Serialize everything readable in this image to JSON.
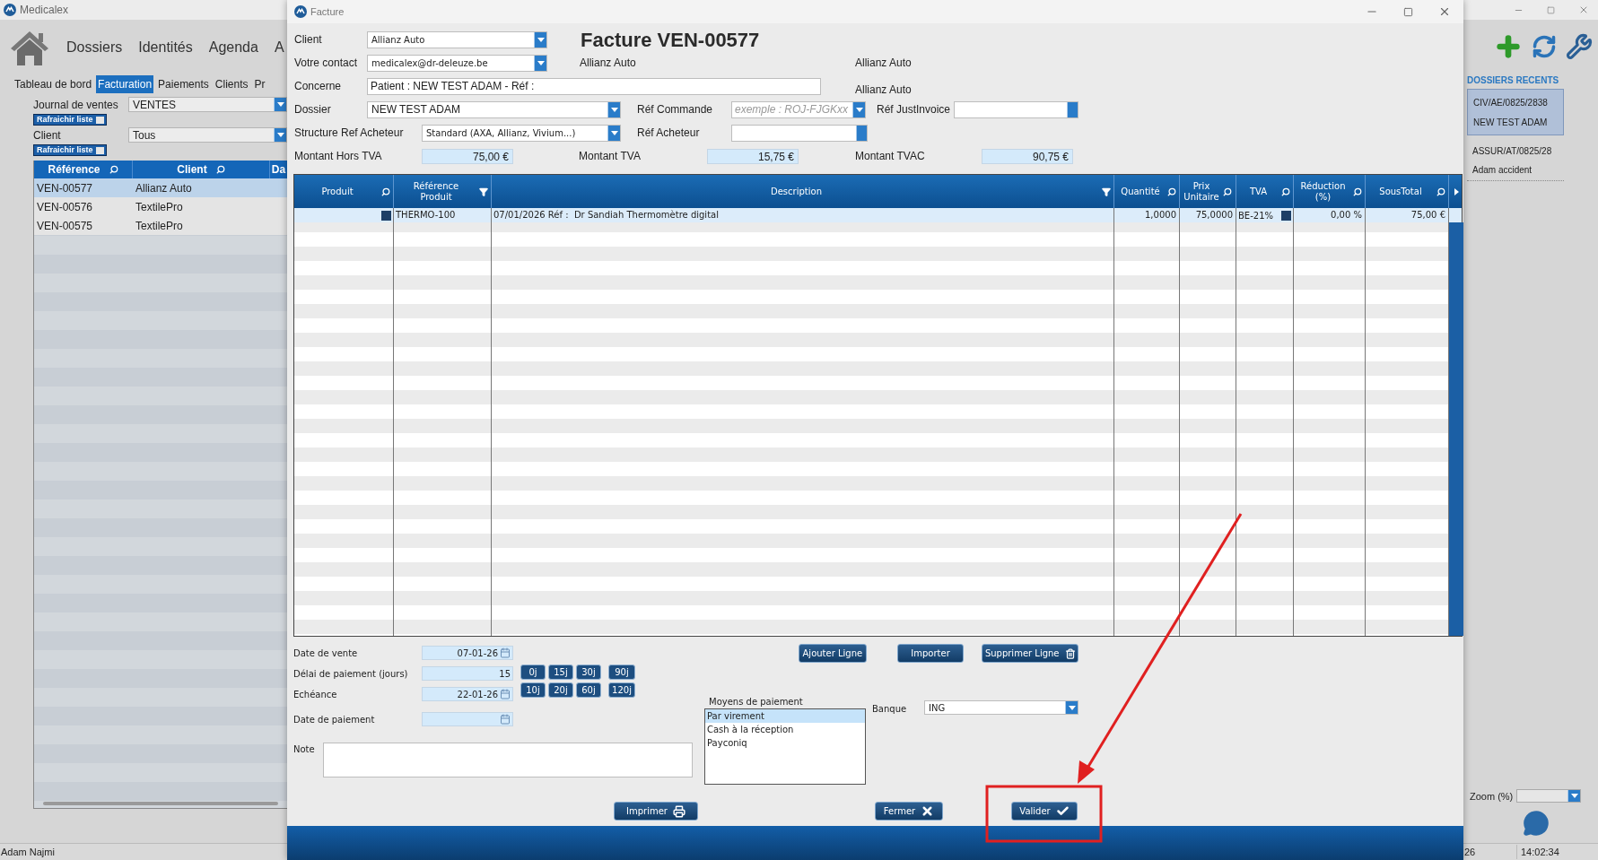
{
  "app": {
    "title": "Medicalex",
    "nav": [
      "Dossiers",
      "Identités",
      "Agenda",
      "A"
    ],
    "tabs": [
      {
        "label": "Tableau de bord",
        "selected": false
      },
      {
        "label": "Facturation",
        "selected": true
      },
      {
        "label": "Paiements",
        "selected": false
      },
      {
        "label": "Clients",
        "selected": false
      },
      {
        "label": "Pr",
        "selected": false
      }
    ],
    "filters": [
      {
        "label": "Journal de ventes",
        "value": "VENTES",
        "refresh": "Rafraichir liste"
      },
      {
        "label": "Client",
        "value": "Tous",
        "refresh": "Rafraichir liste"
      }
    ],
    "invoice_list": {
      "columns": [
        "Référence",
        "Client",
        "Da"
      ],
      "rows": [
        {
          "cells": [
            "VEN-00577",
            "Allianz Auto"
          ],
          "selected": true
        },
        {
          "cells": [
            "VEN-00576",
            "TextilePro"
          ],
          "selected": false
        },
        {
          "cells": [
            "VEN-00575",
            "TextilePro"
          ],
          "selected": false
        }
      ]
    },
    "status_user": "Adam Najmi"
  },
  "dialog": {
    "title": "Facture",
    "heading": "Facture VEN-00577",
    "client": {
      "label": "Client",
      "value": "Allianz Auto"
    },
    "contact": {
      "label": "Votre contact",
      "value": "medicalex@dr-deleuze.be"
    },
    "client_name": "Allianz Auto",
    "address_lines": [
      "Allianz Auto",
      "Allianz Auto"
    ],
    "concerne": {
      "label": "Concerne",
      "value": "Patient : NEW TEST ADAM - Réf :"
    },
    "dossier": {
      "label": "Dossier",
      "value": "NEW TEST ADAM"
    },
    "ref_commande": {
      "label": "Réf Commande",
      "placeholder": "exemple : ROJ-FJGKxx"
    },
    "ref_justinvoice": {
      "label": "Réf JustInvoice"
    },
    "structure": {
      "label": "Structure Ref Acheteur",
      "value": "Standard (AXA, Allianz, Vivium...)"
    },
    "ref_acheteur": {
      "label": "Réf Acheteur"
    },
    "totals": [
      {
        "label": "Montant Hors TVA",
        "value": "75,00 €"
      },
      {
        "label": "Montant TVA",
        "value": "15,75 €"
      },
      {
        "label": "Montant TVAC",
        "value": "90,75 €"
      }
    ],
    "lines": {
      "columns": [
        {
          "label": "Produit",
          "kind": "search"
        },
        {
          "label": "Référence Produit",
          "kind": "filter"
        },
        {
          "label": "Description",
          "kind": "filter"
        },
        {
          "label": "Quantité",
          "kind": "search"
        },
        {
          "label": "Prix Unitaire",
          "kind": "search"
        },
        {
          "label": "TVA",
          "kind": "search"
        },
        {
          "label": "Réduction (%)",
          "kind": "search"
        },
        {
          "label": "SousTotal",
          "kind": "search"
        }
      ],
      "rows": [
        {
          "reference": "THERMO-100",
          "description": "07/01/2026 Réf :  Dr Sandiah Thermomètre digital",
          "quantity": "1,0000",
          "unit_price": "75,0000",
          "vat": "BE-21%",
          "discount": "0,00 %",
          "subtotal": "75,00 €",
          "selected": true
        }
      ]
    },
    "dates": [
      {
        "label": "Date de vente",
        "value": "07-01-26",
        "kind": "date"
      },
      {
        "label": "Délai de paiement (jours)",
        "value": "15",
        "kind": "number"
      },
      {
        "label": "Echéance",
        "value": "22-01-26",
        "kind": "date"
      },
      {
        "label": "Date de paiement",
        "kind": "date"
      }
    ],
    "quick_terms": [
      "0j",
      "15j",
      "30j",
      "90j",
      "10j",
      "20j",
      "60j",
      "120j"
    ],
    "note_label": "Note",
    "line_buttons": [
      {
        "label": "Ajouter Ligne"
      },
      {
        "label": "Importer"
      },
      {
        "label": "Supprimer Ligne"
      }
    ],
    "payment": {
      "label": "Moyens de paiement",
      "options": [
        {
          "label": "Par virement",
          "selected": true
        },
        {
          "label": "Cash à la réception",
          "selected": false
        },
        {
          "label": "Payconiq",
          "selected": false
        }
      ]
    },
    "bank": {
      "label": "Banque",
      "value": "ING"
    },
    "actions": [
      {
        "label": "Imprimer"
      },
      {
        "label": "Fermer"
      },
      {
        "label": "Valider"
      }
    ]
  },
  "side": {
    "heading": "DOSSIERS RECENTS",
    "recent": [
      {
        "code": "CIV/AE/0825/2838",
        "name": "NEW TEST ADAM",
        "selected": true
      },
      {
        "code": "ASSUR/AT/0825/28",
        "name": "Adam accident",
        "selected": false
      }
    ],
    "zoom_label": "Zoom (%)",
    "status": [
      "26",
      "14:02:34"
    ]
  }
}
